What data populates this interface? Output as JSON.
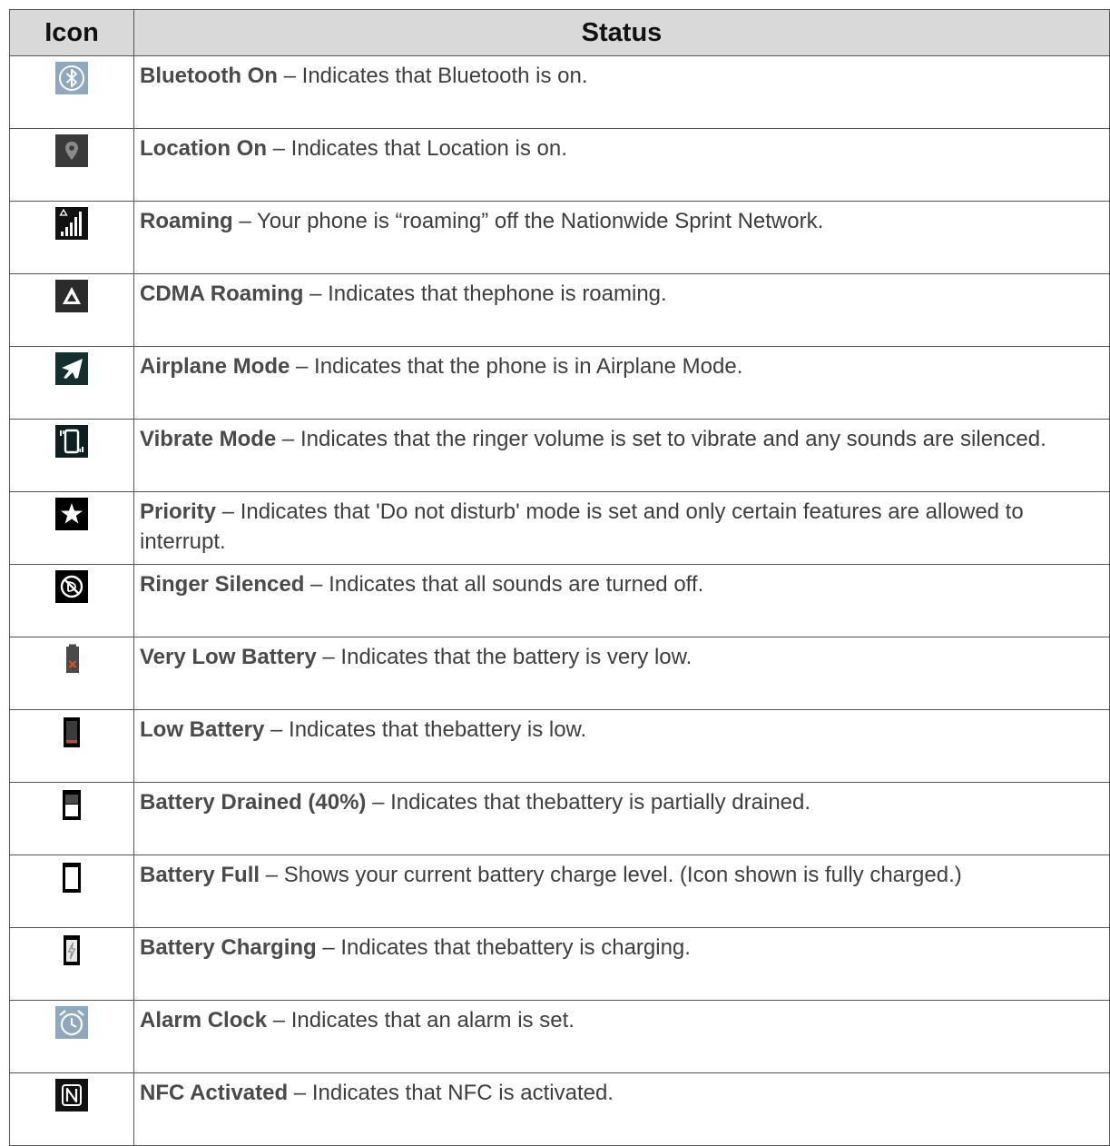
{
  "header": {
    "icon_col": "Icon",
    "status_col": "Status"
  },
  "rows": [
    {
      "icon": "bluetooth-icon",
      "title": "Bluetooth On",
      "desc": " – Indicates that Bluetooth is on."
    },
    {
      "icon": "location-icon",
      "title": "Location On",
      "desc": " – Indicates that Location is on."
    },
    {
      "icon": "roaming-signal-icon",
      "title": "Roaming",
      "desc": " – Your phone is “roaming” off the Nationwide Sprint Network."
    },
    {
      "icon": "cdma-roaming-icon",
      "title": "CDMA Roaming",
      "desc": " – Indicates that thephone is roaming."
    },
    {
      "icon": "airplane-icon",
      "title": "Airplane Mode",
      "desc": " – Indicates that the phone is in Airplane Mode."
    },
    {
      "icon": "vibrate-icon",
      "title": "Vibrate Mode",
      "desc": " – Indicates that the ringer volume is set to vibrate and any sounds are silenced."
    },
    {
      "icon": "star-icon",
      "title": "Priority",
      "desc": " – Indicates that 'Do not disturb' mode is set and only certain features are allowed to interrupt."
    },
    {
      "icon": "ringer-silenced-icon",
      "title": "Ringer Silenced",
      "desc": " – Indicates that all sounds are turned off."
    },
    {
      "icon": "battery-very-low-icon",
      "title": "Very Low Battery",
      "desc": " – Indicates that the battery is very low."
    },
    {
      "icon": "battery-low-icon",
      "title": "Low Battery",
      "desc": " – Indicates that thebattery is low."
    },
    {
      "icon": "battery-drained-icon",
      "title": "Battery Drained (40%)",
      "desc": " – Indicates that thebattery is partially drained."
    },
    {
      "icon": "battery-full-icon",
      "title": "Battery Full",
      "desc": " – Shows your current battery charge level. (Icon shown is fully charged.)"
    },
    {
      "icon": "battery-charging-icon",
      "title": "Battery Charging",
      "desc": " – Indicates that thebattery is charging."
    },
    {
      "icon": "alarm-clock-icon",
      "title": "Alarm Clock",
      "desc": " – Indicates that an alarm is set."
    },
    {
      "icon": "nfc-icon",
      "title": "NFC Activated",
      "desc": " – Indicates that NFC is activated."
    }
  ]
}
